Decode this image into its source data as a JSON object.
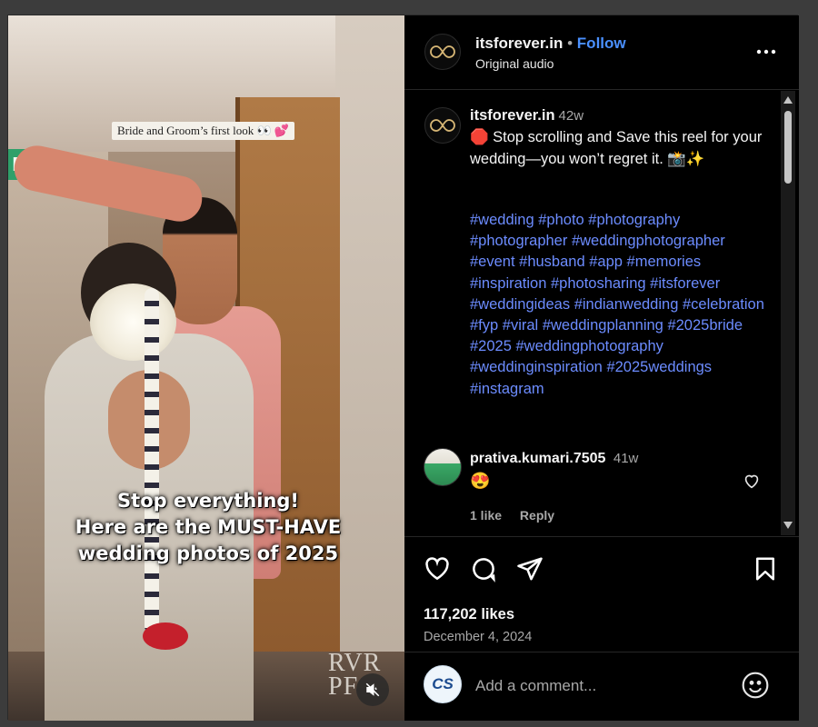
{
  "media": {
    "sign_text": "EXIT",
    "caption_tag": "Bride and Groom’s first look 👀 💕",
    "overlay_text": "Stop everything!\nHere are the MUST-HAVE\nwedding photos of 2025",
    "watermark_line1": "RVR",
    "watermark_line2": "PF",
    "mute_icon": "speaker-muted-icon"
  },
  "header": {
    "username": "itsforever.in",
    "dot": "•",
    "follow_label": "Follow",
    "subtitle": "Original audio",
    "more_icon": "more-horizontal-icon"
  },
  "caption": {
    "username": "itsforever.in",
    "time": "42w",
    "text": "🛑 Stop scrolling and Save this reel for your wedding—you won’t regret it. 📸✨",
    "hashtags": [
      "#wedding",
      "#photo",
      "#photography",
      "#photographer",
      "#weddingphotographer",
      "#event",
      "#husband",
      "#app",
      "#memories",
      "#inspiration",
      "#photosharing",
      "#itsforever",
      "#weddingideas",
      "#indianwedding",
      "#celebration",
      "#fyp",
      "#viral",
      "#weddingplanning",
      "#2025bride",
      "#2025",
      "#weddingphotography",
      "#weddinginspiration",
      "#2025weddings",
      "#instagram"
    ]
  },
  "comment": {
    "username": "prativa.kumari.7505",
    "time": "41w",
    "text": "😍",
    "likes": "1 like",
    "reply": "Reply"
  },
  "actions": {
    "likes": "117,202 likes",
    "date": "December 4, 2024"
  },
  "add_comment": {
    "avatar_text": "CS",
    "placeholder": "Add a comment...",
    "emoji_icon": "smiley-face-icon"
  },
  "colors": {
    "link": "#6c8cff",
    "follow": "#4a90ff",
    "background": "#000000"
  }
}
